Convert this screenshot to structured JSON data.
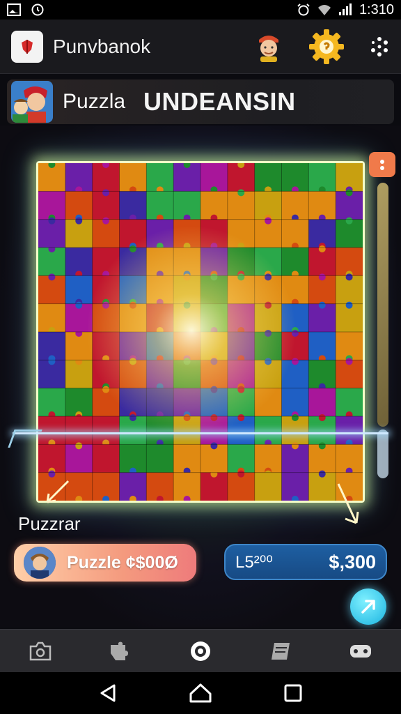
{
  "status_bar": {
    "time": "1:310"
  },
  "app_bar": {
    "title": "Punvbanok"
  },
  "banner": {
    "label": "Puzzla",
    "title": "UNDEANSIN"
  },
  "sub_label": "Puzzrar",
  "puzzle_button": {
    "label": "Puzzle ¢$00Ø"
  },
  "price_button": {
    "left": "L5²⁰⁰",
    "right": "$,300"
  },
  "icons": {
    "status_left": [
      "image-icon",
      "alarm-clock-icon"
    ],
    "status_right": [
      "alarm-icon",
      "wifi-icon",
      "signal-icon"
    ],
    "app_bar": [
      "app-logo-icon",
      "avatar-icon",
      "gear-icon",
      "more-icon"
    ],
    "bottom_nav": [
      "camera-icon",
      "puzzle-piece-icon",
      "target-icon",
      "card-icon",
      "gamepad-icon"
    ],
    "system_nav": [
      "back-icon",
      "home-icon",
      "recents-icon"
    ]
  },
  "colors": {
    "accent_gold": "#f5b820",
    "price_blue": "#1e5fa2",
    "fab_cyan": "#1bb4e0",
    "board_glow": "#f4ffc8"
  }
}
